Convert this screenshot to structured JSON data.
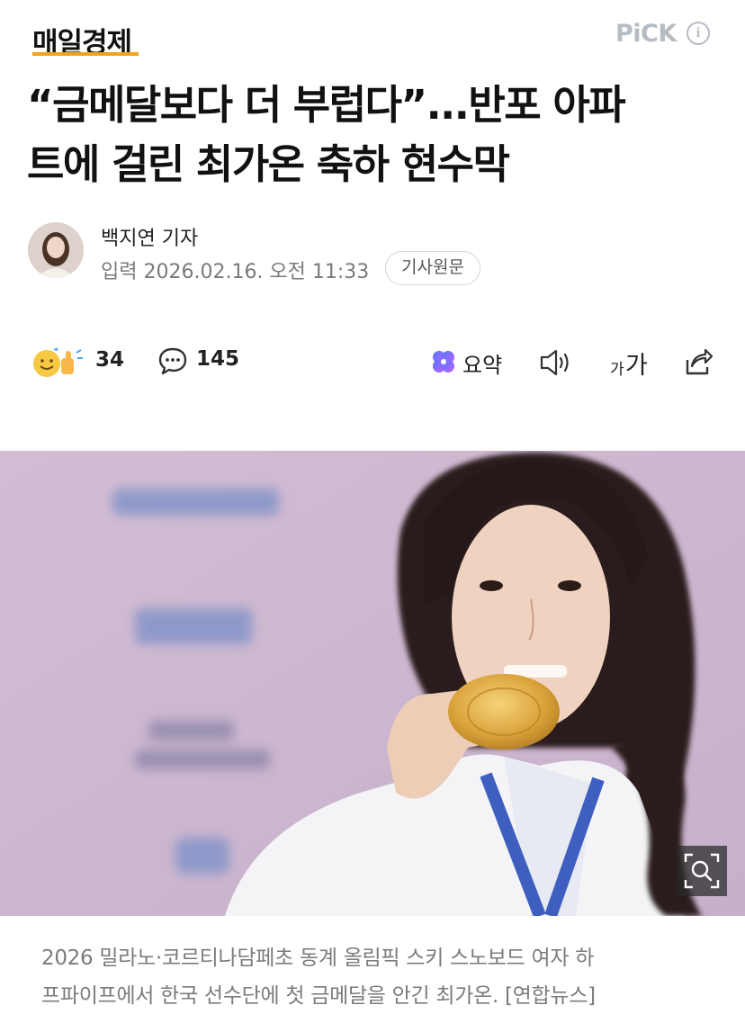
{
  "header": {
    "logo_text": "매일경제",
    "pick_label": "PiCK",
    "info_icon_glyph": "i",
    "accent_color": "#f2a31b"
  },
  "article": {
    "title_line1": "“금메달보다 더 부럽다”...반포 아파",
    "title_line2": "트에 걸린 최가온 축하 현수막",
    "reporter": "백지연 기자",
    "published": "입력 2026.02.16. 오전 11:33",
    "original_button": "기사원문"
  },
  "actions": {
    "reaction_count": "34",
    "comment_count": "145",
    "summary_label": "요약",
    "font_small": "가",
    "font_big": "가",
    "icons": [
      "reaction-emoji-icon",
      "comment-bubble-icon",
      "ai-summary-icon",
      "speaker-icon",
      "share-icon"
    ]
  },
  "photo": {
    "zoom_icon": "zoom-icon",
    "caption_line1": "2026 밀라노·코르티나담페초 동계 올림픽 스키 스노보드 여자 하",
    "caption_line2": "프파이프에서 한국 선수단에 첫 금메달을 안긴 최가온. [연합뉴스]"
  }
}
